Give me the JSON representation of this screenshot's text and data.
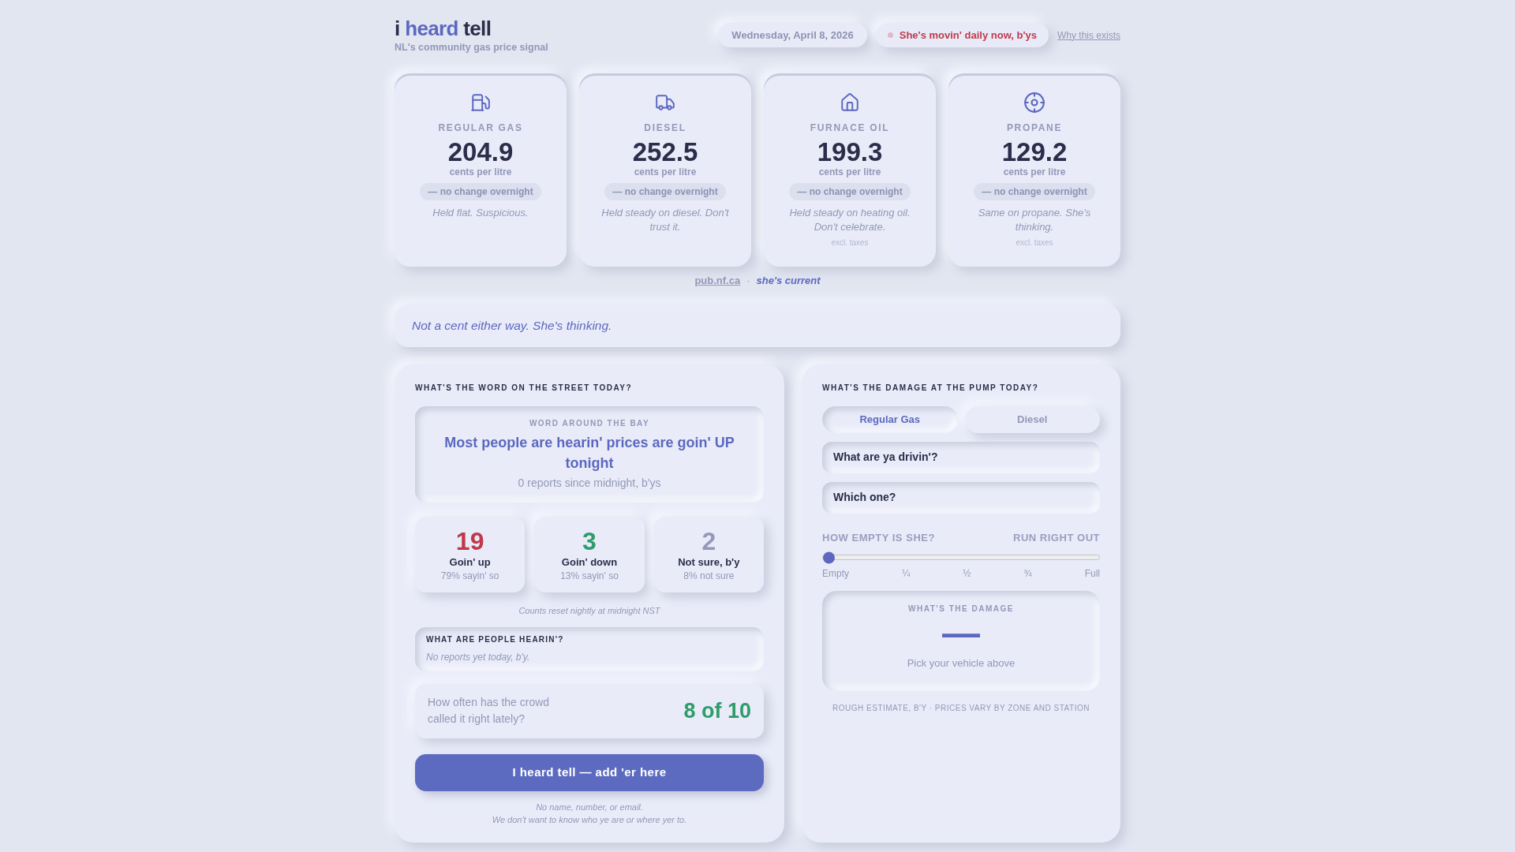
{
  "header": {
    "logo": [
      {
        "text": "i",
        "kind": "plain"
      },
      {
        "text": "heard",
        "kind": "accent"
      },
      {
        "text": "tell",
        "kind": "plain"
      }
    ],
    "tagline": "NL's community gas price signal",
    "date": "Wednesday, April 8, 2026",
    "status": "She's movin' daily now, b'ys",
    "link": "Why this exists"
  },
  "fuels": [
    {
      "kind": "gas",
      "label": "REGULAR GAS",
      "price": "204.9",
      "unit": "cents per litre",
      "change": "— no change overnight",
      "note": "Held flat. Suspicious."
    },
    {
      "kind": "diesel",
      "label": "DIESEL",
      "price": "252.5",
      "unit": "cents per litre",
      "change": "— no change overnight",
      "note": "Held steady on diesel. Don't trust it."
    },
    {
      "kind": "furnace_oil",
      "label": "FURNACE OIL",
      "price": "199.3",
      "unit": "cents per litre",
      "change": "— no change overnight",
      "note": "Held steady on heating oil. Don't celebrate.",
      "footnote": "excl. taxes"
    },
    {
      "kind": "propane",
      "label": "PROPANE",
      "price": "129.2",
      "unit": "cents per litre",
      "change": "— no change overnight",
      "note": "Same on propane. She's thinking.",
      "footnote": "excl. taxes"
    }
  ],
  "source": {
    "link": "pub.nf.ca",
    "separator": "·",
    "status": "she's current"
  },
  "banner": "Not a cent either way. She's thinking.",
  "street": {
    "heading": "WHAT'S THE WORD ON THE STREET TODAY?",
    "consensus": {
      "eyebrow": "WORD AROUND THE BAY",
      "headline": "Most people are hearin' prices are goin' UP tonight",
      "count": "0 reports since midnight, b'ys"
    },
    "votes": [
      {
        "value": "19",
        "label": "Goin' up",
        "share": "79% sayin' so",
        "color": "#c0394b"
      },
      {
        "value": "3",
        "label": "Goin' down",
        "share": "13% sayin' so",
        "color": "#2e9d6b"
      },
      {
        "value": "2",
        "label": "Not sure, b'y",
        "share": "8% not sure",
        "color": "#9598b9"
      }
    ],
    "reset_note": "Counts reset nightly at midnight NST",
    "hearin": {
      "heading": "WHAT ARE PEOPLE HEARIN'?",
      "empty_text": "No reports yet today, b'y."
    },
    "accuracy": {
      "question": "How often has the crowd called it right lately?",
      "score": "8 of 10"
    },
    "button": "I heard tell — add 'er here",
    "privacy": [
      "No name, number, or email.",
      "We don't want to know who ye are or where yer to."
    ]
  },
  "pump": {
    "heading": "WHAT'S THE DAMAGE AT THE PUMP TODAY?",
    "tabs": [
      {
        "label": "Regular Gas",
        "selected": true
      },
      {
        "label": "Diesel",
        "selected": false
      }
    ],
    "selects": [
      {
        "placeholder": "What are ya drivin'?"
      },
      {
        "placeholder": "Which one?"
      }
    ],
    "slider": {
      "label": "HOW EMPTY IS SHE?",
      "reading": "RUN RIGHT OUT",
      "level": 0,
      "ticks": [
        "Empty",
        "¼",
        "½",
        "¾",
        "Full"
      ]
    },
    "estimate": {
      "heading": "WHAT'S THE DAMAGE",
      "value": "—",
      "hint": "Pick your vehicle above"
    },
    "disclaimer": "ROUGH ESTIMATE, B'Y · PRICES VARY BY ZONE AND STATION"
  }
}
